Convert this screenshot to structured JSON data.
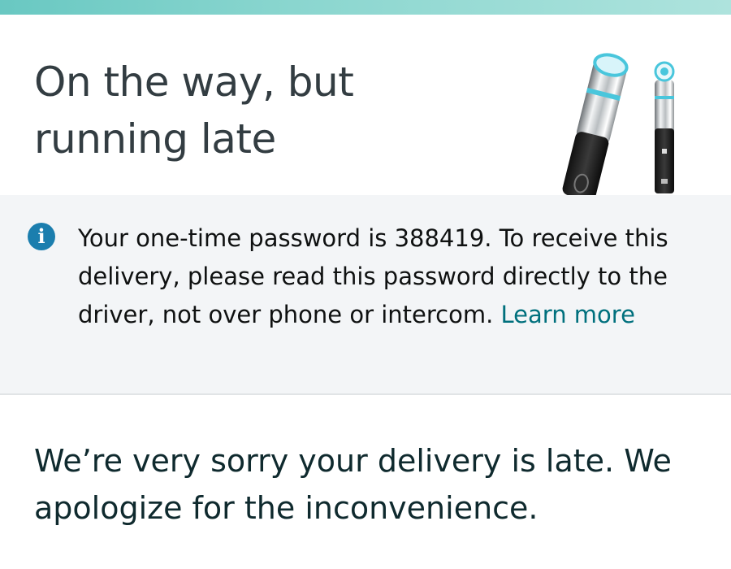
{
  "header": {
    "status_title_line1": "On the way, but",
    "status_title_line2": "running late"
  },
  "product": {
    "image": "facial-massager-device"
  },
  "notice": {
    "icon": "info-icon",
    "message": "Your one-time password is 388419. To receive this delivery, please read this password directly to the driver, not over phone or intercom. ",
    "link_label": "Learn more"
  },
  "apology": {
    "message": "We’re very sorry your delivery is late. We apologize for the inconvenience."
  },
  "colors": {
    "accent_strip": "#69c8c2",
    "link": "#00707d",
    "info_icon": "#1b7eae",
    "notice_bg": "#f3f5f7",
    "title_text": "#333d42"
  }
}
